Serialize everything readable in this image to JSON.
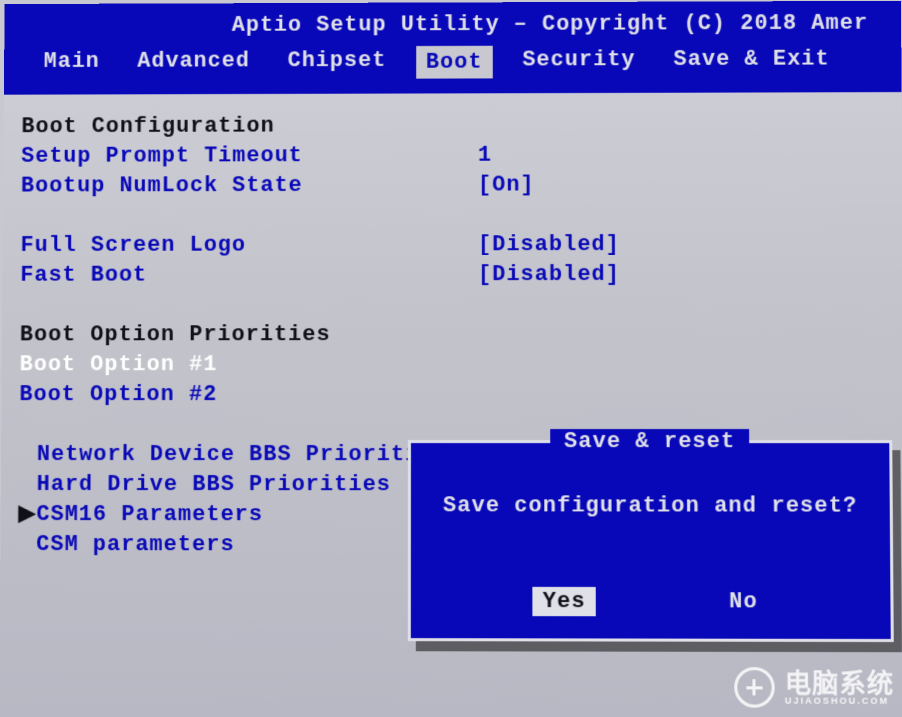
{
  "header": {
    "title": "Aptio Setup Utility – Copyright (C) 2018 Amer"
  },
  "tabs": [
    {
      "label": "Main",
      "active": false
    },
    {
      "label": "Advanced",
      "active": false
    },
    {
      "label": "Chipset",
      "active": false
    },
    {
      "label": "Boot",
      "active": true
    },
    {
      "label": "Security",
      "active": false
    },
    {
      "label": "Save & Exit",
      "active": false
    }
  ],
  "boot": {
    "section_config": "Boot Configuration",
    "items": [
      {
        "label": "Setup Prompt Timeout",
        "value": "1"
      },
      {
        "label": "Bootup NumLock State",
        "value": "[On]"
      }
    ],
    "items2": [
      {
        "label": "Full Screen Logo",
        "value": "[Disabled]"
      },
      {
        "label": "Fast Boot",
        "value": "[Disabled]"
      }
    ],
    "section_priorities": "Boot Option Priorities",
    "boot_option_1": "Boot Option #1",
    "boot_option_2": "Boot Option #2",
    "submenus": [
      {
        "label": "Network Device BBS Priorities",
        "marker": false
      },
      {
        "label": "Hard Drive BBS Priorities",
        "marker": false
      },
      {
        "label": "CSM16 Parameters",
        "marker": true
      },
      {
        "label": "CSM parameters",
        "marker": false
      }
    ]
  },
  "dialog": {
    "title": "Save & reset",
    "message": "Save configuration and reset?",
    "yes": "Yes",
    "no": "No"
  },
  "watermark": {
    "main": "电脑系统",
    "sub": "UJIAOSHOU.COM"
  }
}
